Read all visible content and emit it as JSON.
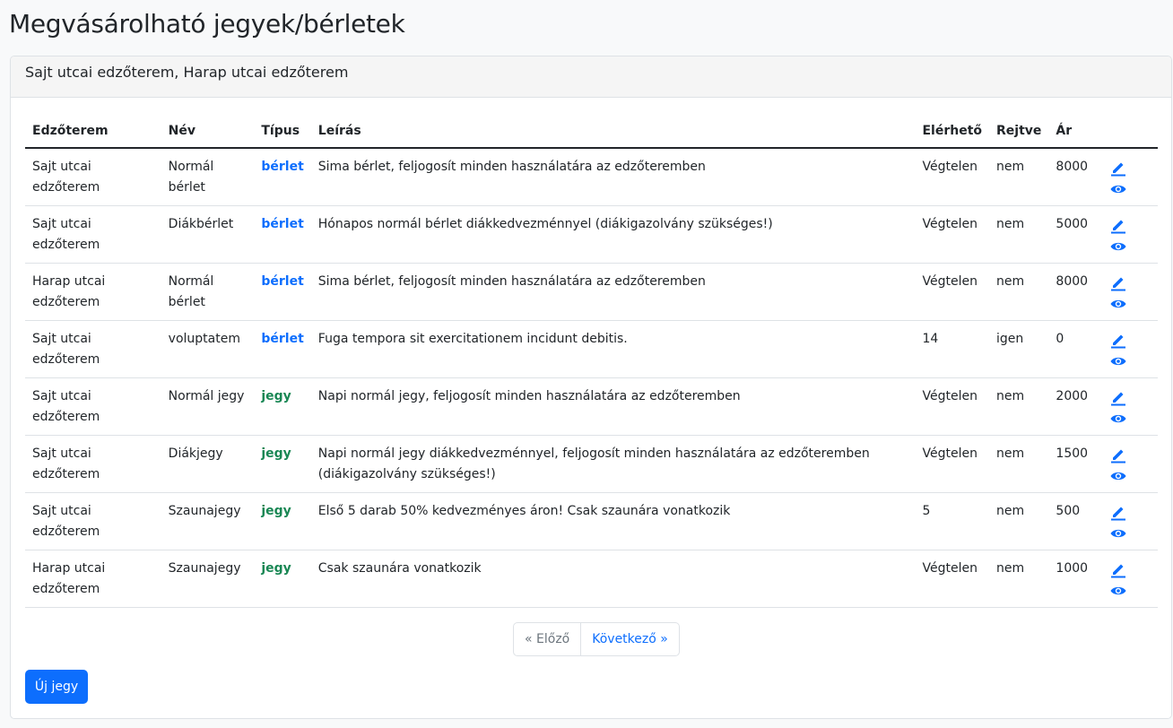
{
  "page": {
    "title": "Megvásárolható jegyek/bérletek"
  },
  "card": {
    "header": "Sajt utcai edzőterem, Harap utcai edzőterem"
  },
  "table": {
    "headers": [
      "Edzőterem",
      "Név",
      "Típus",
      "Leírás",
      "Elérhető",
      "Rejtve",
      "Ár",
      ""
    ],
    "rows": [
      {
        "gym": "Sajt utcai edzőterem",
        "name": "Normál bérlet",
        "type": "bérlet",
        "desc": "Sima bérlet, feljogosít minden használatára az edzőteremben",
        "available": "Végtelen",
        "hidden": "nem",
        "price": "8000"
      },
      {
        "gym": "Sajt utcai edzőterem",
        "name": "Diákbérlet",
        "type": "bérlet",
        "desc": "Hónapos normál bérlet diákkedvezménnyel (diákigazolvány szükséges!)",
        "available": "Végtelen",
        "hidden": "nem",
        "price": "5000"
      },
      {
        "gym": "Harap utcai edzőterem",
        "name": "Normál bérlet",
        "type": "bérlet",
        "desc": "Sima bérlet, feljogosít minden használatára az edzőteremben",
        "available": "Végtelen",
        "hidden": "nem",
        "price": "8000"
      },
      {
        "gym": "Sajt utcai edzőterem",
        "name": "voluptatem",
        "type": "bérlet",
        "desc": "Fuga tempora sit exercitationem incidunt debitis.",
        "available": "14",
        "hidden": "igen",
        "price": "0"
      },
      {
        "gym": "Sajt utcai edzőterem",
        "name": "Normál jegy",
        "type": "jegy",
        "desc": "Napi normál jegy, feljogosít minden használatára az edzőteremben",
        "available": "Végtelen",
        "hidden": "nem",
        "price": "2000"
      },
      {
        "gym": "Sajt utcai edzőterem",
        "name": "Diákjegy",
        "type": "jegy",
        "desc": "Napi normál jegy diákkedvezménnyel, feljogosít minden használatára az edzőteremben (diákigazolvány szükséges!)",
        "available": "Végtelen",
        "hidden": "nem",
        "price": "1500"
      },
      {
        "gym": "Sajt utcai edzőterem",
        "name": "Szaunajegy",
        "type": "jegy",
        "desc": "Első 5 darab 50% kedvezményes áron! Csak szaunára vonatkozik",
        "available": "5",
        "hidden": "nem",
        "price": "500"
      },
      {
        "gym": "Harap utcai edzőterem",
        "name": "Szaunajegy",
        "type": "jegy",
        "desc": "Csak szaunára vonatkozik",
        "available": "Végtelen",
        "hidden": "nem",
        "price": "1000"
      }
    ]
  },
  "pagination": {
    "prev": "« Előző",
    "next": "Következő »"
  },
  "actions": {
    "new_label": "Új jegy",
    "edit_icon": "pencil-icon",
    "view_icon": "eye-icon"
  },
  "colors": {
    "primary": "#0d6efd",
    "success": "#198754"
  }
}
